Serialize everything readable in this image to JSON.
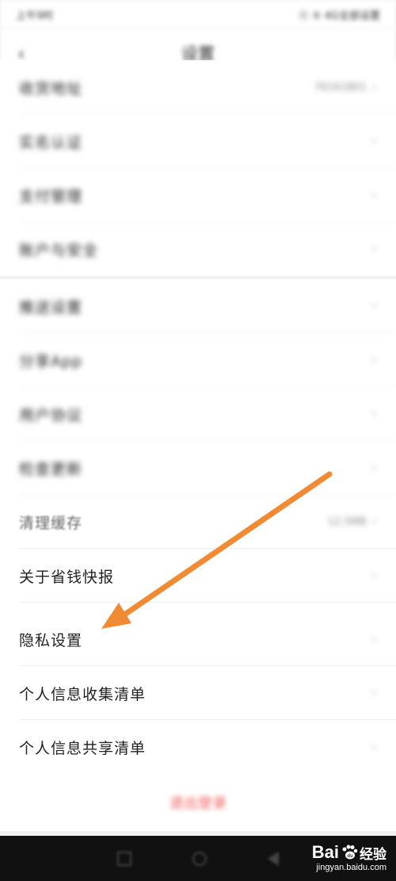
{
  "status_bar": {
    "time": "上午9时",
    "right": "ⓝ ⑤ 4G全部设置"
  },
  "nav": {
    "back_glyph": "‹",
    "title": "设置"
  },
  "group1": [
    {
      "label": "收货地址",
      "value": "76161801"
    },
    {
      "label": "实名认证",
      "value": ""
    },
    {
      "label": "支付管理",
      "value": ""
    },
    {
      "label": "账户与安全",
      "value": ""
    }
  ],
  "group2": [
    {
      "label": "推送设置",
      "value": ""
    },
    {
      "label": "分享App",
      "value": ""
    },
    {
      "label": "用户协议",
      "value": ""
    },
    {
      "label": "检查更新",
      "value": ""
    },
    {
      "label": "清理缓存",
      "value": "12.5MB"
    },
    {
      "label": "关于省钱快报",
      "value": ""
    },
    {
      "label": "隐私设置",
      "value": ""
    },
    {
      "label": "个人信息收集清单",
      "value": ""
    },
    {
      "label": "个人信息共享清单",
      "value": ""
    }
  ],
  "logout_label": "退出登录",
  "watermark": {
    "bai": "Bai",
    "du": "经验",
    "url": "jingyan.baidu.com"
  },
  "colors": {
    "arrow": "#f08a33",
    "logout": "#f05a5a"
  }
}
